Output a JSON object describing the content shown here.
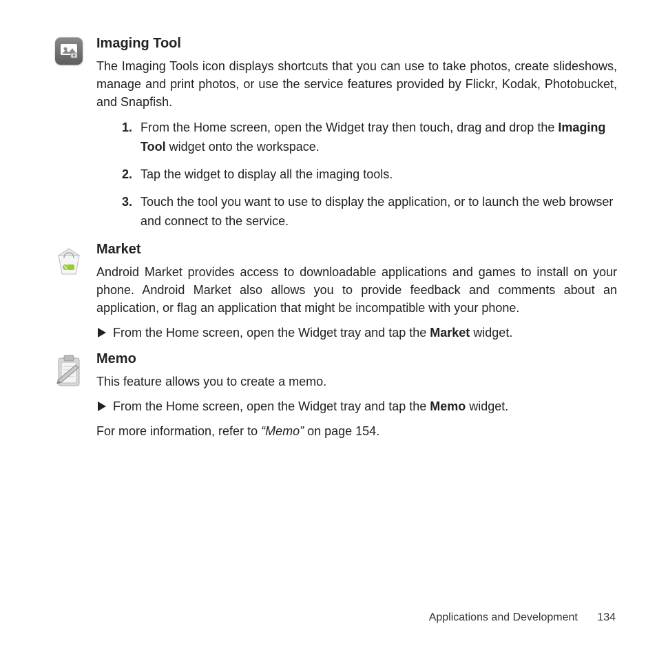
{
  "sections": {
    "imaging": {
      "heading": "Imaging Tool",
      "desc": "The Imaging Tools icon displays shortcuts that you can use to take photos, create slideshows, manage and print photos, or use the service features provided by Flickr, Kodak, Photobucket, and Snapfish.",
      "steps": [
        {
          "num": "1.",
          "pre": "From the Home screen, open the Widget tray then touch, drag and drop the ",
          "bold": "Imaging Tool",
          "post": " widget onto the workspace."
        },
        {
          "num": "2.",
          "text": "Tap the widget to display all the imaging tools."
        },
        {
          "num": "3.",
          "text": "Touch the tool you want to use to display the application, or to launch the web browser and connect to the service."
        }
      ]
    },
    "market": {
      "heading": "Market",
      "desc": "Android Market provides access to downloadable applications and games to install on your phone. Android Market also allows you to provide feedback and comments about an application, or flag an application that might be incompatible with your phone.",
      "bullet": {
        "pre": "From the Home screen, open the Widget tray and tap the ",
        "bold": "Market",
        "post": " widget."
      }
    },
    "memo": {
      "heading": "Memo",
      "desc": "This feature allows you to create a memo.",
      "bullet": {
        "pre": "From the Home screen, open the Widget tray and tap the ",
        "bold": "Memo",
        "post": " widget."
      },
      "ref_pre": "For more information, refer to ",
      "ref_italic": "“Memo”",
      "ref_post": "  on page 154."
    }
  },
  "footer": {
    "section": "Applications and Development",
    "page": "134"
  }
}
